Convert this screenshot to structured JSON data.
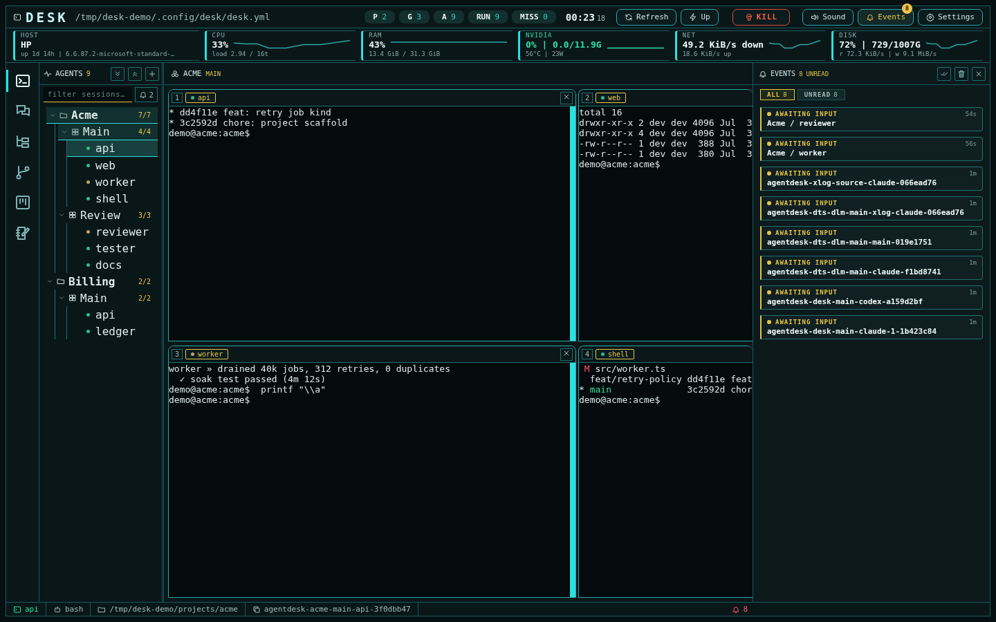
{
  "header": {
    "app_name": "DESK",
    "config_path": "/tmp/desk-demo/.config/desk/desk.yml",
    "counters": [
      {
        "label": "P",
        "value": "2"
      },
      {
        "label": "G",
        "value": "3"
      },
      {
        "label": "A",
        "value": "9"
      },
      {
        "label": "RUN",
        "value": "9"
      },
      {
        "label": "MISS",
        "value": "0"
      }
    ],
    "clock": {
      "time": "00:23",
      "seconds": "18"
    },
    "buttons": [
      {
        "kind": "refresh",
        "label": "Refresh",
        "active": false
      },
      {
        "kind": "up",
        "label": "Up",
        "active": false
      },
      {
        "kind": "kill",
        "label": "KILL",
        "active": false
      },
      {
        "kind": "sound",
        "label": "Sound",
        "active": false
      },
      {
        "kind": "events",
        "label": "Events",
        "active": true,
        "badge": "8"
      },
      {
        "kind": "settings",
        "label": "Settings",
        "active": false
      }
    ]
  },
  "stats": [
    {
      "label": "HOST",
      "value": "HP",
      "detail": "up 1d 14h | 6.6.87.2-microsoft-standard-…",
      "kind": "plain"
    },
    {
      "label": "CPU",
      "value": "33%",
      "detail": "load 2.94 / 16t",
      "kind": "spark"
    },
    {
      "label": "RAM",
      "value": "43%",
      "detail": "13.4 GiB / 31.3 GiB",
      "kind": "flat"
    },
    {
      "label": "NVIDIA",
      "value": "0% | 0.0/11.9G",
      "detail": "56°C | 23W",
      "kind": "gpu"
    },
    {
      "label": "NET",
      "value": "49.2 KiB/s down",
      "detail": "18.6 KiB/s up",
      "kind": "spark"
    },
    {
      "label": "DISK",
      "value": "72% | 729/1007G",
      "detail": "r 72.3 KiB/s | w 9.1 MiB/s",
      "kind": "spark"
    }
  ],
  "rail": [
    {
      "kind": "terminal",
      "selected": true
    },
    {
      "kind": "chat",
      "selected": false
    },
    {
      "kind": "tree",
      "selected": false
    },
    {
      "kind": "branch",
      "selected": false
    },
    {
      "kind": "board",
      "selected": false
    },
    {
      "kind": "notes",
      "selected": false
    }
  ],
  "agents": {
    "title": "AGENTS",
    "count": "9",
    "filter": {
      "placeholder": "filter sessions…"
    },
    "bell_count": "2",
    "tree": [
      {
        "kind": "project",
        "label": "Acme",
        "count": "7/7",
        "expanded": true,
        "selected": false,
        "on_path": true,
        "children": [
          {
            "kind": "group",
            "label": "Main",
            "count": "4/4",
            "expanded": true,
            "selected": false,
            "on_path": true,
            "children": [
              {
                "kind": "agent",
                "label": "api",
                "color": "#2fbf8a",
                "selected": true
              },
              {
                "kind": "agent",
                "label": "web",
                "color": "#2fbf8a",
                "selected": false
              },
              {
                "kind": "agent",
                "label": "worker",
                "color": "#c9a063",
                "selected": false
              },
              {
                "kind": "agent",
                "label": "shell",
                "color": "#2fbf8a",
                "selected": false
              }
            ]
          },
          {
            "kind": "group",
            "label": "Review",
            "count": "3/3",
            "expanded": true,
            "selected": false,
            "on_path": false,
            "children": [
              {
                "kind": "agent",
                "label": "reviewer",
                "color": "#c9a063",
                "selected": false
              },
              {
                "kind": "agent",
                "label": "tester",
                "color": "#2fbf8a",
                "selected": false
              },
              {
                "kind": "agent",
                "label": "docs",
                "color": "#2fbf8a",
                "selected": false
              }
            ]
          }
        ]
      },
      {
        "kind": "project",
        "label": "Billing",
        "count": "2/2",
        "expanded": true,
        "selected": false,
        "on_path": false,
        "children": [
          {
            "kind": "group",
            "label": "Main",
            "count": "2/2",
            "expanded": true,
            "selected": false,
            "on_path": false,
            "children": [
              {
                "kind": "agent",
                "label": "api",
                "color": "#2fbf8a",
                "selected": false
              },
              {
                "kind": "agent",
                "label": "ledger",
                "color": "#2fbf8a",
                "selected": false
              }
            ]
          }
        ]
      }
    ]
  },
  "workspace": {
    "title": "ACME",
    "branch": "MAIN",
    "panes": [
      {
        "number": "1",
        "tab": "api",
        "color": "#2fbf8a",
        "closable": true,
        "lines": [
          [
            {
              "text": "* dd4f11e feat: retry job kind",
              "kind": "plain"
            }
          ],
          [
            {
              "text": "* 3c2592d chore: project scaffold",
              "kind": "plain"
            }
          ],
          [
            {
              "text": "demo@acme:acme$",
              "kind": "plain"
            }
          ]
        ]
      },
      {
        "number": "2",
        "tab": "web",
        "color": "#2fbf8a",
        "closable": false,
        "lines": [
          [
            {
              "text": "total 16",
              "kind": "plain"
            }
          ],
          [
            {
              "text": "drwxr-xr-x 2 dev dev 4096 Jul  3",
              "kind": "plain"
            }
          ],
          [
            {
              "text": "drwxr-xr-x 4 dev dev 4096 Jul  3",
              "kind": "plain"
            }
          ],
          [
            {
              "text": "-rw-r--r-- 1 dev dev  388 Jul  3",
              "kind": "plain"
            }
          ],
          [
            {
              "text": "-rw-r--r-- 1 dev dev  380 Jul  3",
              "kind": "plain"
            }
          ],
          [
            {
              "text": "demo@acme:acme$",
              "kind": "plain"
            }
          ]
        ]
      },
      {
        "number": "3",
        "tab": "worker",
        "color": "#c9a063",
        "closable": true,
        "lines": [
          [
            {
              "text": "worker » drained 40k jobs, 312 retries, 0 duplicates",
              "kind": "plain"
            }
          ],
          [
            {
              "text": "  ✓ soak test passed (4m 12s)",
              "kind": "plain"
            }
          ],
          [
            {
              "text": "demo@acme:acme$  printf \"\\\\a\"",
              "kind": "plain"
            }
          ],
          [
            {
              "text": "demo@acme:acme$",
              "kind": "plain"
            }
          ]
        ]
      },
      {
        "number": "4",
        "tab": "shell",
        "color": "#2fbf8a",
        "closable": false,
        "lines": [
          [
            {
              "text": " M",
              "kind": "modified"
            },
            {
              "text": " src/worker.ts",
              "kind": "plain"
            }
          ],
          [
            {
              "text": "  feat/retry-policy dd4f11e feat",
              "kind": "plain"
            }
          ],
          [
            {
              "text": "*",
              "kind": "plain"
            },
            {
              "text": " main",
              "kind": "current"
            },
            {
              "text": "              3c2592d chor",
              "kind": "plain"
            }
          ],
          [
            {
              "text": "demo@acme:acme$",
              "kind": "plain"
            }
          ]
        ]
      }
    ]
  },
  "events": {
    "title": "EVENTS",
    "count": "8",
    "unread_label": "UNREAD",
    "tabs": [
      {
        "label": "ALL",
        "count": "8",
        "selected": true
      },
      {
        "label": "UNREAD",
        "count": "8",
        "selected": false
      }
    ],
    "items": [
      {
        "status": "AWAITING INPUT",
        "title": "Acme / reviewer",
        "time": "54s"
      },
      {
        "status": "AWAITING INPUT",
        "title": "Acme / worker",
        "time": "56s"
      },
      {
        "status": "AWAITING INPUT",
        "title": "agentdesk-xlog-source-claude-066ead76",
        "time": "1m"
      },
      {
        "status": "AWAITING INPUT",
        "title": "agentdesk-dts-dlm-main-xlog-claude-066ead76",
        "time": "1m"
      },
      {
        "status": "AWAITING INPUT",
        "title": "agentdesk-dts-dlm-main-main-019e1751",
        "time": "1m"
      },
      {
        "status": "AWAITING INPUT",
        "title": "agentdesk-dts-dlm-main-claude-f1bd8741",
        "time": "1m"
      },
      {
        "status": "AWAITING INPUT",
        "title": "agentdesk-desk-main-codex-a159d2bf",
        "time": "1m"
      },
      {
        "status": "AWAITING INPUT",
        "title": "agentdesk-desk-main-claude-1-1b423c84",
        "time": "1m"
      }
    ]
  },
  "status_bar": {
    "items": [
      {
        "kind": "session",
        "text": "api"
      },
      {
        "kind": "shell",
        "text": "bash"
      },
      {
        "kind": "folder",
        "text": "/tmp/desk-demo/projects/acme"
      },
      {
        "kind": "copy",
        "text": "agentdesk-acme-main-api-3f0dbb47"
      }
    ],
    "alerts": "8"
  }
}
